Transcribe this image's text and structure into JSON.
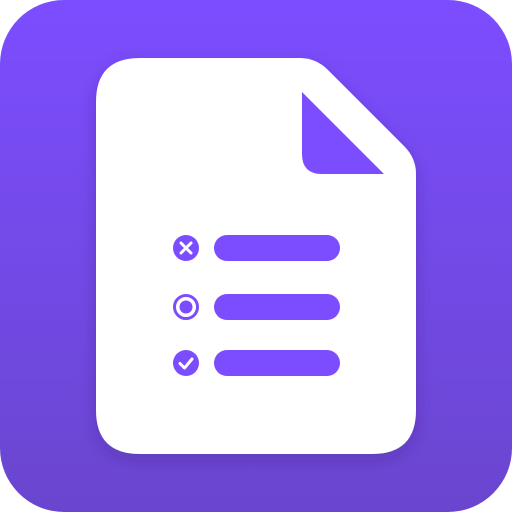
{
  "icon": {
    "name": "forms-app-icon",
    "colors": {
      "background_top": "#7C4DFF",
      "background_bottom": "#6A46CF",
      "document": "#FFFFFF",
      "accent": "#7C4DFF"
    },
    "items": [
      {
        "state_icon": "x-circle-icon"
      },
      {
        "state_icon": "radio-selected-icon"
      },
      {
        "state_icon": "check-circle-icon"
      }
    ]
  }
}
